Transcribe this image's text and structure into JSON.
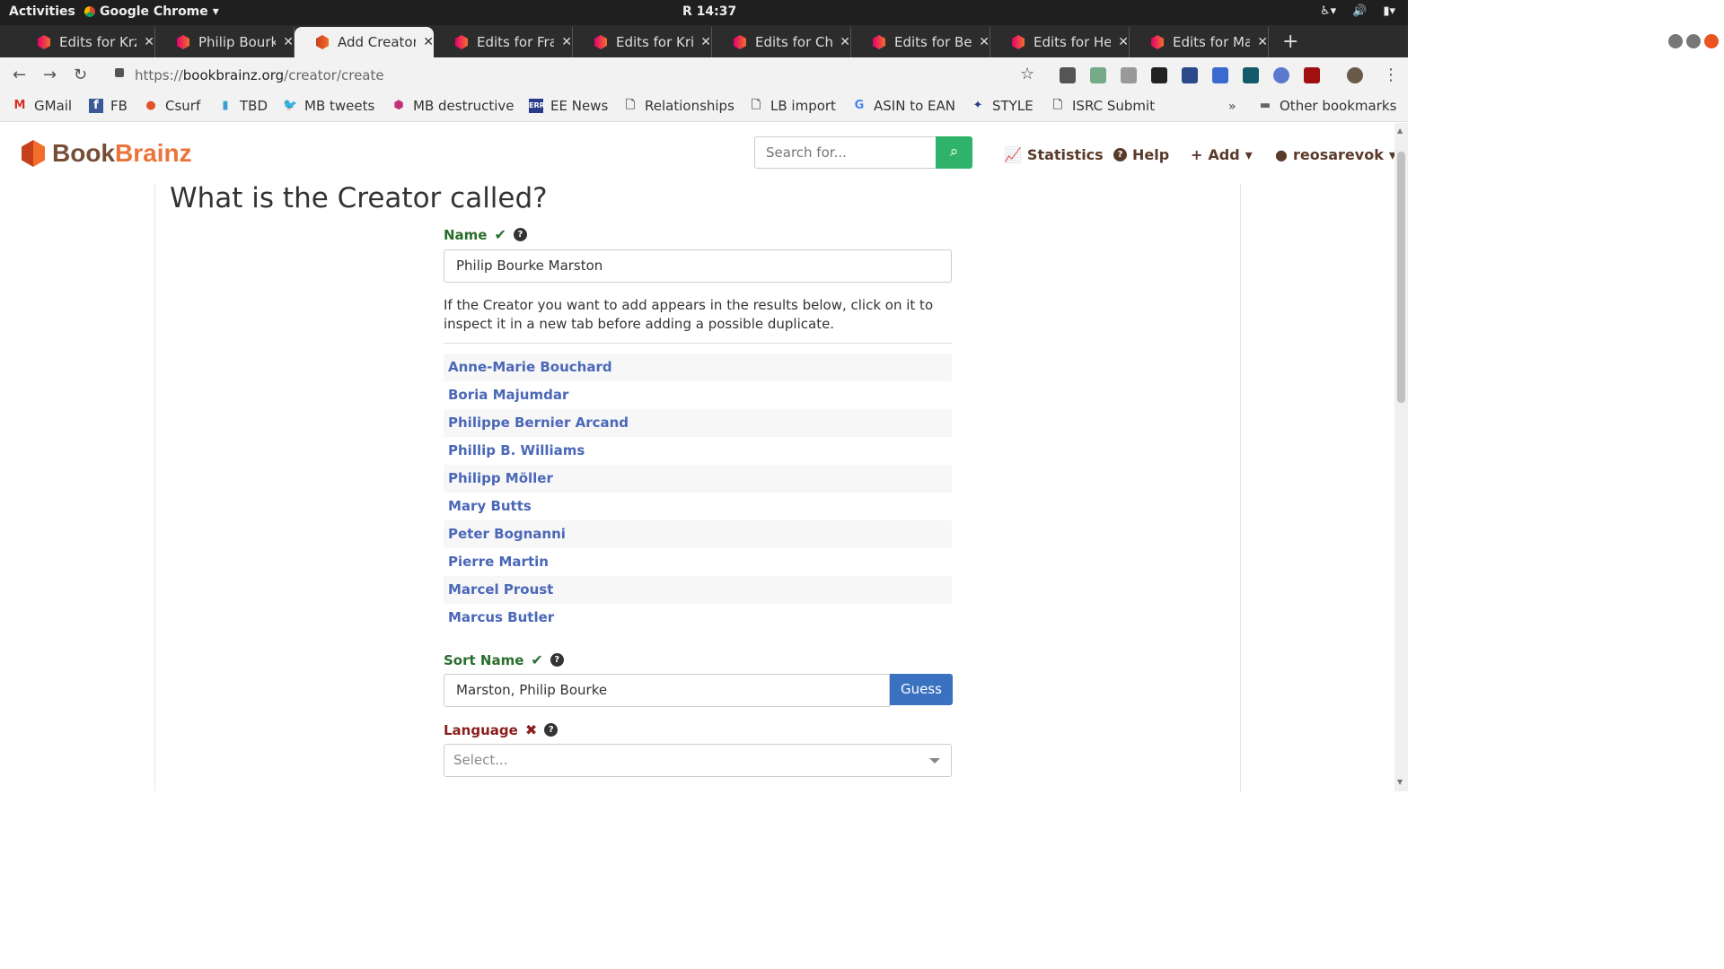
{
  "system": {
    "activities": "Activities",
    "app_name": "Google Chrome",
    "clock": "R 14:37"
  },
  "tabs": [
    {
      "label": "Edits for Krz",
      "active": false
    },
    {
      "label": "Philip Bourke",
      "active": false
    },
    {
      "label": "Add Creator",
      "active": true
    },
    {
      "label": "Edits for Fra",
      "active": false
    },
    {
      "label": "Edits for Kri",
      "active": false
    },
    {
      "label": "Edits for Ch",
      "active": false
    },
    {
      "label": "Edits for Be",
      "active": false
    },
    {
      "label": "Edits for He",
      "active": false
    },
    {
      "label": "Edits for Ma",
      "active": false
    }
  ],
  "address": {
    "scheme": "https://",
    "host": "bookbrainz.org",
    "path": "/creator/create"
  },
  "bookmarks": [
    {
      "label": "GMail",
      "icon": "gmail-icon"
    },
    {
      "label": "FB",
      "icon": "facebook-icon"
    },
    {
      "label": "Csurf",
      "icon": "couchsurfing-icon"
    },
    {
      "label": "TBD",
      "icon": "bookmark-icon"
    },
    {
      "label": "MB tweets",
      "icon": "twitter-icon"
    },
    {
      "label": "MB destructive",
      "icon": "metabrainz-icon"
    },
    {
      "label": "EE News",
      "icon": "news-icon"
    },
    {
      "label": "Relationships",
      "icon": "page-icon"
    },
    {
      "label": "LB import",
      "icon": "page-icon"
    },
    {
      "label": "ASIN to EAN",
      "icon": "google-icon"
    },
    {
      "label": "STYLE",
      "icon": "style-icon"
    },
    {
      "label": "ISRC Submit",
      "icon": "page-icon"
    }
  ],
  "bookmarks_more": "»",
  "other_bookmarks": "Other bookmarks",
  "site": {
    "logo_part1": "Book",
    "logo_part2": "Brainz",
    "search_placeholder": "Search for...",
    "nav": {
      "statistics": "Statistics",
      "help": "Help",
      "add": "Add",
      "user": "reosarevok"
    }
  },
  "form": {
    "heading": "What is the Creator called?",
    "name_label": "Name",
    "name_value": "Philip Bourke Marston",
    "hint": "If the Creator you want to add appears in the results below, click on it to inspect it in a new tab before adding a possible duplicate.",
    "results": [
      "Anne-Marie Bouchard",
      "Boria Majumdar",
      "Philippe Bernier Arcand",
      "Phillip B. Williams",
      "Philipp Möller",
      "Mary Butts",
      "Peter Bognanni",
      "Pierre Martin",
      "Marcel Proust",
      "Marcus Butler"
    ],
    "sort_name_label": "Sort Name",
    "sort_name_value": "Marston, Philip Bourke",
    "guess_button": "Guess",
    "language_label": "Language",
    "language_placeholder": "Select..."
  },
  "colors": {
    "valid": "#2a6e2d",
    "invalid": "#8b1e1e",
    "link": "#4a67b8",
    "search_button": "#2fb36a",
    "guess_button": "#3a71c1"
  }
}
